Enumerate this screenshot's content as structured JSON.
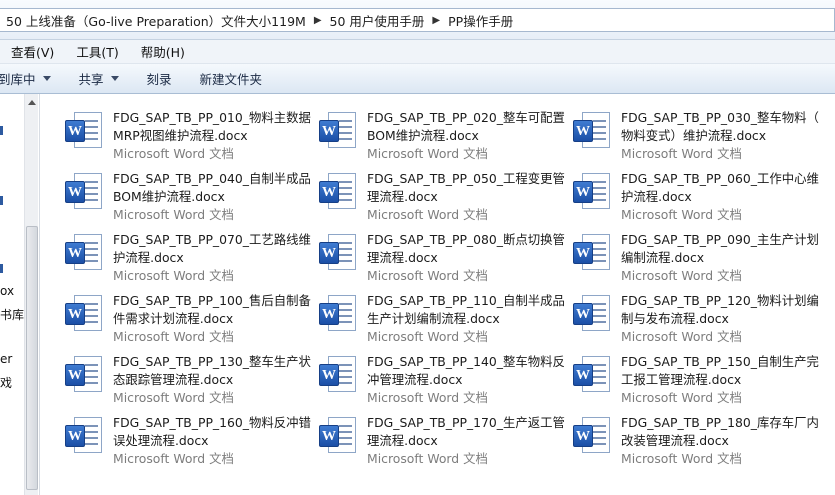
{
  "address": {
    "crumbs": [
      "50 上线准备（Go-live Preparation）文件大小119M",
      "50 用户使用手册",
      "PP操作手册"
    ]
  },
  "menubar": {
    "items": [
      "查看(V)",
      "工具(T)",
      "帮助(H)"
    ]
  },
  "toolbar": {
    "include_library": "到库中",
    "share": "共享",
    "burn": "刻录",
    "new_folder": "新建文件夹"
  },
  "nav": {
    "fragments": [
      "ox",
      "书库",
      "er",
      "戏"
    ]
  },
  "file_type": "Microsoft Word 文档",
  "files": [
    {
      "line1": "FDG_SAP_TB_PP_010_物料主数据",
      "line2": "MRP视图维护流程.docx"
    },
    {
      "line1": "FDG_SAP_TB_PP_020_整车可配置",
      "line2": "BOM维护流程.docx"
    },
    {
      "line1": "FDG_SAP_TB_PP_030_整车物料（",
      "line2": "物料变式）维护流程.docx"
    },
    {
      "line1": "FDG_SAP_TB_PP_040_自制半成品",
      "line2": "BOM维护流程.docx"
    },
    {
      "line1": "FDG_SAP_TB_PP_050_工程变更管",
      "line2": "理流程.docx"
    },
    {
      "line1": "FDG_SAP_TB_PP_060_工作中心维",
      "line2": "护流程.docx"
    },
    {
      "line1": "FDG_SAP_TB_PP_070_工艺路线维",
      "line2": "护流程.docx"
    },
    {
      "line1": "FDG_SAP_TB_PP_080_断点切换管",
      "line2": "理流程.docx"
    },
    {
      "line1": "FDG_SAP_TB_PP_090_主生产计划",
      "line2": "编制流程.docx"
    },
    {
      "line1": "FDG_SAP_TB_PP_100_售后自制备",
      "line2": "件需求计划流程.docx"
    },
    {
      "line1": "FDG_SAP_TB_PP_110_自制半成品",
      "line2": "生产计划编制流程.docx"
    },
    {
      "line1": "FDG_SAP_TB_PP_120_物料计划编",
      "line2": "制与发布流程.docx"
    },
    {
      "line1": "FDG_SAP_TB_PP_130_整车生产状",
      "line2": "态跟踪管理流程.docx"
    },
    {
      "line1": "FDG_SAP_TB_PP_140_整车物料反",
      "line2": "冲管理流程.docx"
    },
    {
      "line1": "FDG_SAP_TB_PP_150_自制生产完",
      "line2": "工报工管理流程.docx"
    },
    {
      "line1": "FDG_SAP_TB_PP_160_物料反冲错",
      "line2": "误处理流程.docx"
    },
    {
      "line1": "FDG_SAP_TB_PP_170_生产返工管",
      "line2": "理流程.docx"
    },
    {
      "line1": "FDG_SAP_TB_PP_180_库存车厂内",
      "line2": "改装管理流程.docx"
    }
  ]
}
